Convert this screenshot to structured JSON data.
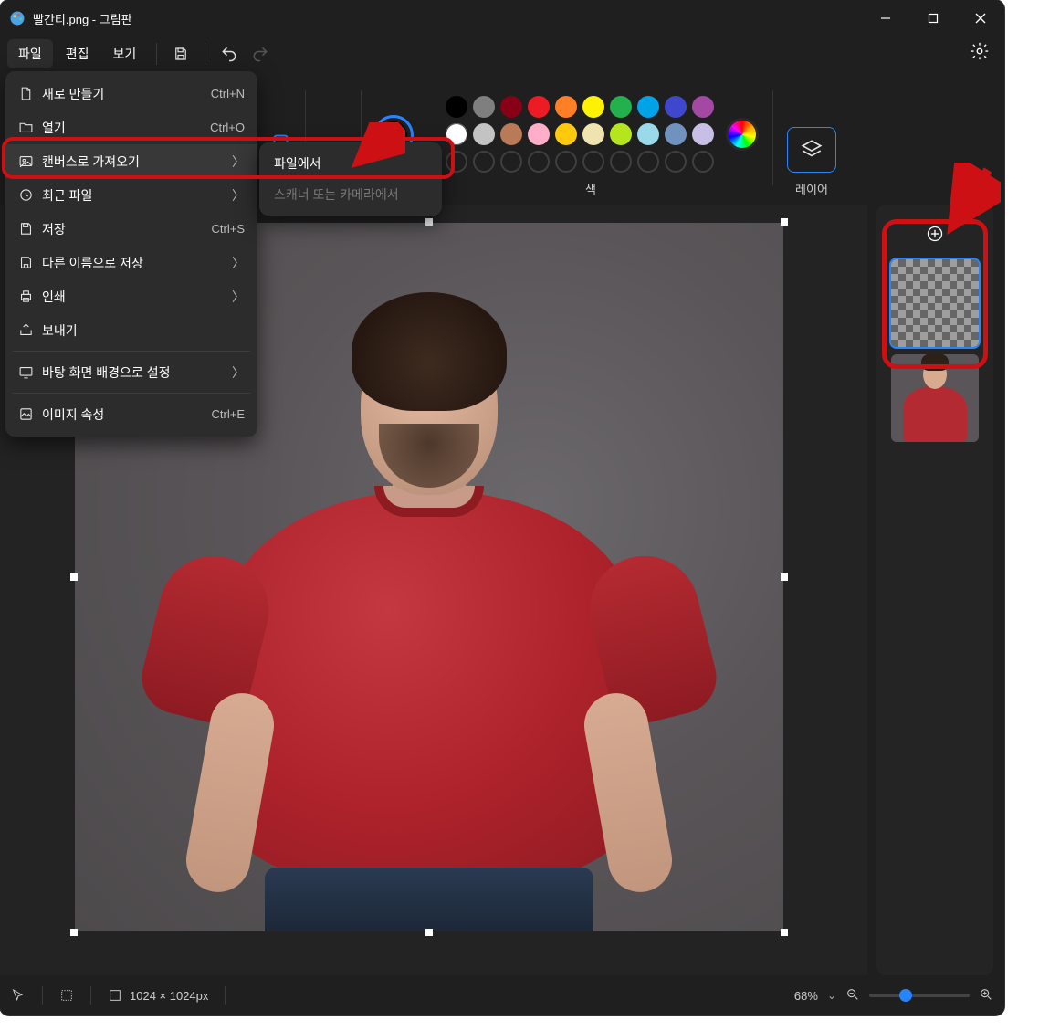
{
  "window": {
    "title": "빨간티.png - 그림판"
  },
  "menubar": {
    "file": "파일",
    "edit": "편집",
    "view": "보기"
  },
  "file_menu": {
    "new": {
      "label": "새로 만들기",
      "shortcut": "Ctrl+N"
    },
    "open": {
      "label": "열기",
      "shortcut": "Ctrl+O"
    },
    "import": {
      "label": "캔버스로 가져오기"
    },
    "recent": {
      "label": "최근 파일"
    },
    "save": {
      "label": "저장",
      "shortcut": "Ctrl+S"
    },
    "saveas": {
      "label": "다른 이름으로 저장"
    },
    "print": {
      "label": "인쇄"
    },
    "export": {
      "label": "보내기"
    },
    "set_wallpaper": {
      "label": "바탕 화면 배경으로 설정"
    },
    "properties": {
      "label": "이미지 속성",
      "shortcut": "Ctrl+E"
    }
  },
  "submenu": {
    "from_file": "파일에서",
    "from_scanner": "스캐너 또는 카메라에서"
  },
  "ribbon": {
    "colors_label": "색",
    "layers_label": "레이어",
    "palette": [
      "#000000",
      "#7f7f7f",
      "#880015",
      "#ed1c24",
      "#ff7f27",
      "#fff200",
      "#22b14c",
      "#00a2e8",
      "#3f48cc",
      "#a349a4",
      "#ffffff",
      "#c3c3c3",
      "#b97a57",
      "#ffaec9",
      "#ffc90e",
      "#efe4b0",
      "#b5e61d",
      "#99d9ea",
      "#7092be",
      "#c8bfe7"
    ],
    "accent_color": "#000000"
  },
  "status": {
    "dimensions": "1024 × 1024px",
    "zoom": "68%"
  }
}
